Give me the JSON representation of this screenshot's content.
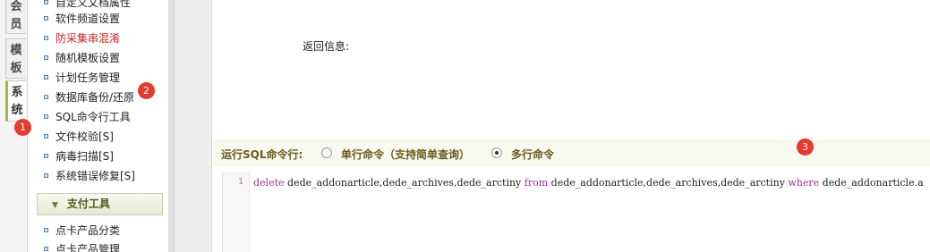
{
  "tabs": [
    {
      "label": "会员"
    },
    {
      "label": "模板"
    },
    {
      "label": "系统"
    }
  ],
  "menu": {
    "items": [
      {
        "label": "自定义文档属性"
      },
      {
        "label": "软件频道设置"
      },
      {
        "label": "防采集串混淆"
      },
      {
        "label": "随机模板设置"
      },
      {
        "label": "计划任务管理"
      },
      {
        "label": "数据库备份/还原"
      },
      {
        "label": "SQL命令行工具"
      },
      {
        "label": "文件校验[S]"
      },
      {
        "label": "病毒扫描[S]"
      },
      {
        "label": "系统错误修复[S]"
      }
    ],
    "group_title": "支付工具",
    "group_items": [
      {
        "label": "点卡产品分类"
      },
      {
        "label": "点卡产品管理"
      }
    ]
  },
  "main": {
    "return_label": "返回信息:",
    "cmd_title": "运行SQL命令行:",
    "radio_single": "单行命令（支持简单查询）",
    "radio_multi": "多行命令",
    "selected": "multi",
    "editor": {
      "line_number": "1",
      "kw_delete": "delete",
      "tables": " dede_addonarticle,dede_archives,dede_arctiny ",
      "kw_from": "from",
      "tables2": " dede_addonarticle,dede_archives,dede_arctiny ",
      "kw_where": "where",
      "condition": " dede_addonarticle.a"
    }
  },
  "markers": [
    "1",
    "2",
    "3"
  ],
  "colors": {
    "accent_green": "#9fbb43",
    "marker_red": "#e63a2e",
    "warning_red": "#cc2222"
  }
}
